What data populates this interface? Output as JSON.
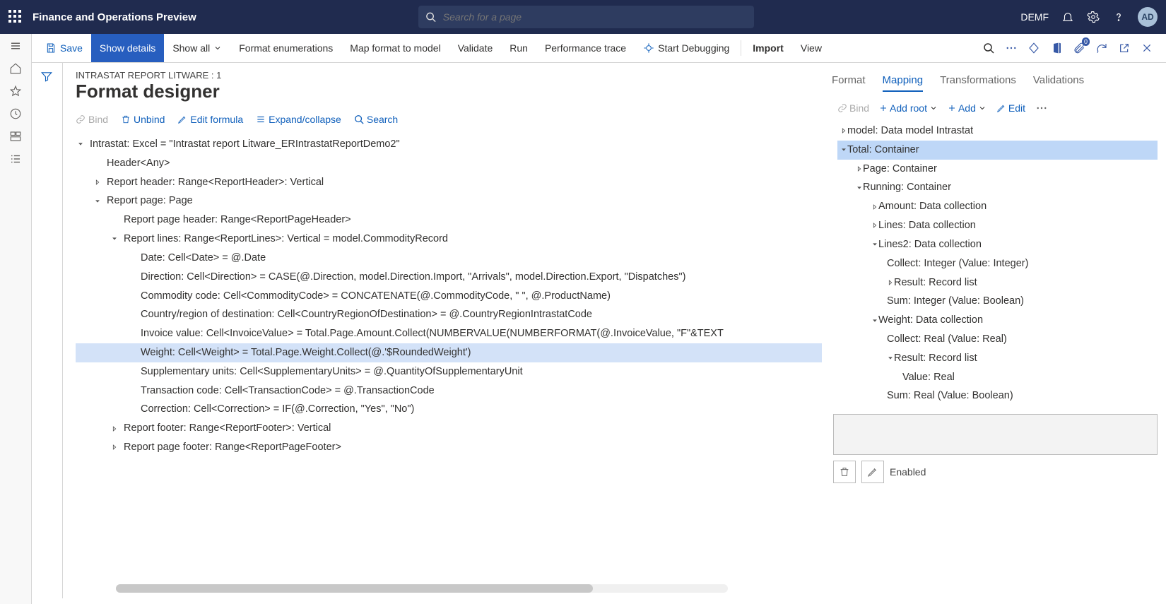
{
  "top": {
    "app_title": "Finance and Operations Preview",
    "search_placeholder": "Search for a page",
    "company": "DEMF",
    "avatar": "AD"
  },
  "cmd": {
    "save": "Save",
    "show_details": "Show details",
    "show_all": "Show all",
    "format_enum": "Format enumerations",
    "map_format": "Map format to model",
    "validate": "Validate",
    "run": "Run",
    "perf": "Performance trace",
    "start_debug": "Start Debugging",
    "import": "Import",
    "view": "View",
    "badge": "0"
  },
  "page": {
    "crumb": "INTRASTAT REPORT LITWARE : 1",
    "title": "Format designer"
  },
  "toolbar2": {
    "bind": "Bind",
    "unbind": "Unbind",
    "edit_formula": "Edit formula",
    "expand": "Expand/collapse",
    "search": "Search"
  },
  "tree": [
    {
      "indent": 0,
      "arrow": "down",
      "text": "Intrastat: Excel = \"Intrastat report Litware_ERIntrastatReportDemo2\""
    },
    {
      "indent": 1,
      "arrow": "none",
      "text": "Header<Any>"
    },
    {
      "indent": 1,
      "arrow": "right",
      "text": "Report header: Range<ReportHeader>: Vertical"
    },
    {
      "indent": 1,
      "arrow": "down",
      "text": "Report page: Page"
    },
    {
      "indent": 2,
      "arrow": "none",
      "text": "Report page header: Range<ReportPageHeader>"
    },
    {
      "indent": 2,
      "arrow": "down",
      "text": "Report lines: Range<ReportLines>: Vertical = model.CommodityRecord"
    },
    {
      "indent": 3,
      "arrow": "none",
      "text": "Date: Cell<Date> = @.Date"
    },
    {
      "indent": 3,
      "arrow": "none",
      "text": "Direction: Cell<Direction> = CASE(@.Direction, model.Direction.Import, \"Arrivals\", model.Direction.Export, \"Dispatches\")"
    },
    {
      "indent": 3,
      "arrow": "none",
      "text": "Commodity code: Cell<CommodityCode> = CONCATENATE(@.CommodityCode, \" \", @.ProductName)"
    },
    {
      "indent": 3,
      "arrow": "none",
      "text": "Country/region of destination: Cell<CountryRegionOfDestination> = @.CountryRegionIntrastatCode"
    },
    {
      "indent": 3,
      "arrow": "none",
      "text": "Invoice value: Cell<InvoiceValue> = Total.Page.Amount.Collect(NUMBERVALUE(NUMBERFORMAT(@.InvoiceValue, \"F\"&TEXT"
    },
    {
      "indent": 3,
      "arrow": "none",
      "highlight": true,
      "text": "Weight: Cell<Weight> = Total.Page.Weight.Collect(@.'$RoundedWeight')"
    },
    {
      "indent": 3,
      "arrow": "none",
      "text": "Supplementary units: Cell<SupplementaryUnits> = @.QuantityOfSupplementaryUnit"
    },
    {
      "indent": 3,
      "arrow": "none",
      "text": "Transaction code: Cell<TransactionCode> = @.TransactionCode"
    },
    {
      "indent": 3,
      "arrow": "none",
      "text": "Correction: Cell<Correction> = IF(@.Correction, \"Yes\", \"No\")"
    },
    {
      "indent": 2,
      "arrow": "right",
      "text": "Report footer: Range<ReportFooter>: Vertical"
    },
    {
      "indent": 2,
      "arrow": "right",
      "text": "Report page footer: Range<ReportPageFooter>"
    }
  ],
  "rtabs": {
    "format": "Format",
    "mapping": "Mapping",
    "transformations": "Transformations",
    "validations": "Validations"
  },
  "rtoolbar": {
    "bind": "Bind",
    "add_root": "Add root",
    "add": "Add",
    "edit": "Edit"
  },
  "rtree": [
    {
      "indent": 0,
      "arrow": "right",
      "text": "model: Data model Intrastat"
    },
    {
      "indent": 0,
      "arrow": "down",
      "selected": true,
      "text": "Total: Container"
    },
    {
      "indent": 1,
      "arrow": "right",
      "text": "Page: Container"
    },
    {
      "indent": 1,
      "arrow": "down",
      "text": "Running: Container"
    },
    {
      "indent": 2,
      "arrow": "right",
      "text": "Amount: Data collection"
    },
    {
      "indent": 2,
      "arrow": "right",
      "text": "Lines: Data collection"
    },
    {
      "indent": 2,
      "arrow": "down",
      "text": "Lines2: Data collection"
    },
    {
      "indent": 3,
      "arrow": "none",
      "text": "Collect: Integer (Value: Integer)"
    },
    {
      "indent": 3,
      "arrow": "right",
      "text": "Result: Record list"
    },
    {
      "indent": 3,
      "arrow": "none",
      "text": "Sum: Integer (Value: Boolean)"
    },
    {
      "indent": 2,
      "arrow": "down",
      "text": "Weight: Data collection"
    },
    {
      "indent": 3,
      "arrow": "none",
      "text": "Collect: Real (Value: Real)"
    },
    {
      "indent": 3,
      "arrow": "down",
      "text": "Result: Record list"
    },
    {
      "indent": 4,
      "arrow": "none",
      "text": "Value: Real"
    },
    {
      "indent": 3,
      "arrow": "none",
      "text": "Sum: Real (Value: Boolean)"
    }
  ],
  "bottom": {
    "enabled": "Enabled"
  }
}
